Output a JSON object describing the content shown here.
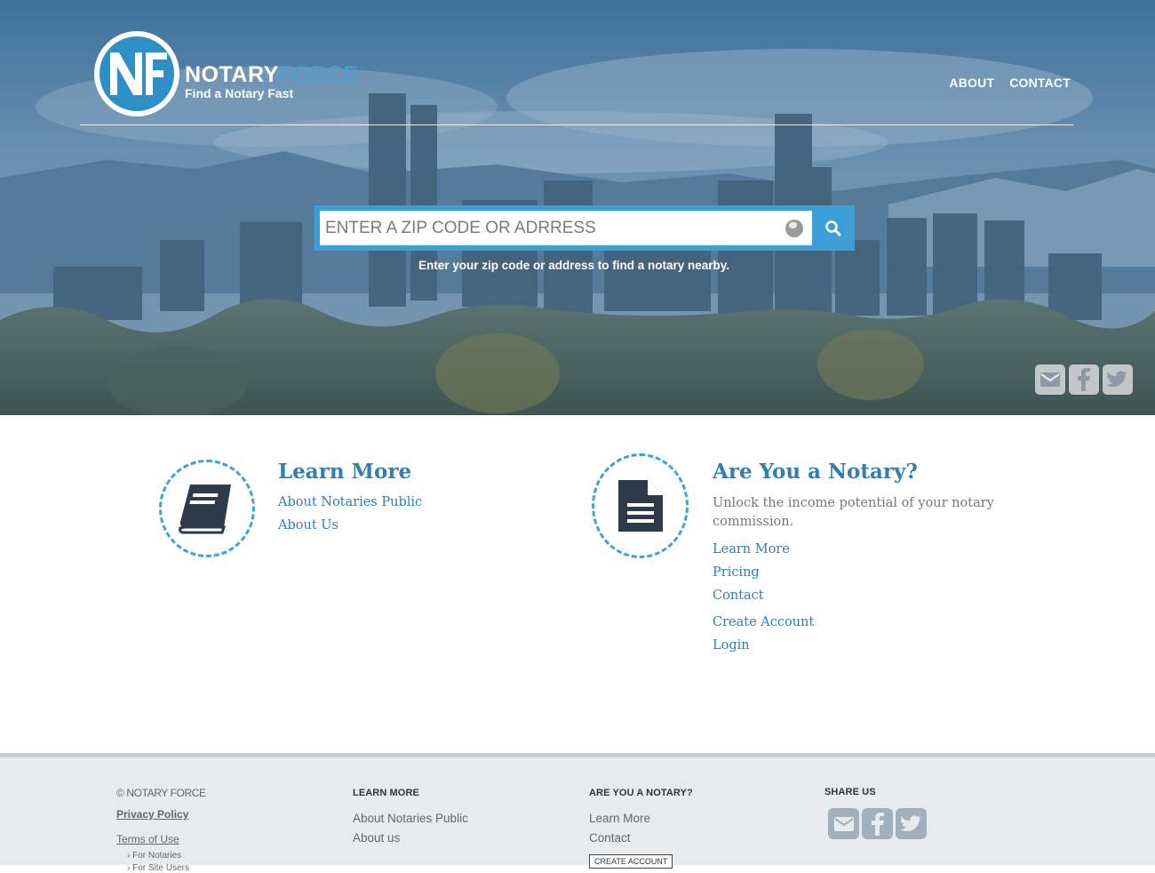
{
  "header": {
    "brand_primary": "NOTARY",
    "brand_secondary": "FORCE",
    "tagline": "Find a Notary Fast",
    "nav": [
      {
        "label": "ABOUT"
      },
      {
        "label": "CONTACT"
      }
    ]
  },
  "search": {
    "placeholder": "ENTER A ZIP CODE OR ADRRESS",
    "value": "",
    "hint": "Enter your zip code or address to find a notary nearby."
  },
  "learn_more": {
    "title": "Learn More",
    "links": [
      "About Notaries Public",
      "About Us"
    ]
  },
  "notary": {
    "title": "Are You a Notary?",
    "description": "Unlock the income potential of your notary commission.",
    "links": [
      "Learn More",
      "Pricing",
      "Contact",
      "Create Account",
      "Login"
    ]
  },
  "footer": {
    "copyright": "© NOTARY FORCE",
    "privacy": "Privacy Policy",
    "terms": "Terms of Use",
    "terms_sub": [
      "For Notaries",
      "For Site Users"
    ],
    "learn_more": {
      "heading": "LEARN MORE",
      "links": [
        "About Notaries Public",
        "About us"
      ]
    },
    "notary": {
      "heading": "ARE YOU A NOTARY?",
      "links": [
        "Learn More",
        "Contact"
      ],
      "button": "CREATE ACCOUNT"
    },
    "share": {
      "heading": "SHARE US"
    }
  },
  "icons": {
    "email": "envelope-icon",
    "facebook": "facebook-icon",
    "twitter": "twitter-icon",
    "search": "search-icon",
    "globe": "globe-icon",
    "book": "book-icon",
    "document": "document-icon"
  },
  "colors": {
    "accent": "#2f7fb2",
    "search_blue": "#3b9fd6",
    "dashed_ring": "#3ea3d9",
    "icon_dark": "#2d3a4a",
    "footer_bg": "#e8ebed"
  }
}
